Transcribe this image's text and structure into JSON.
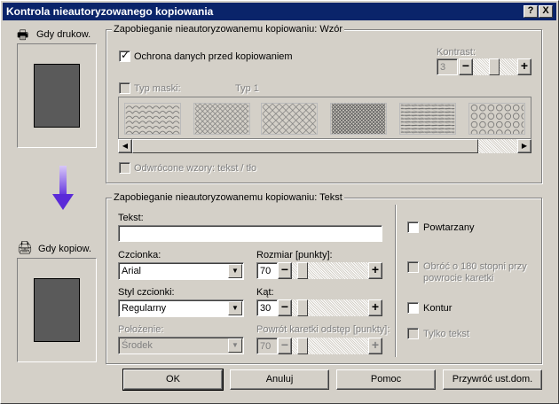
{
  "window": {
    "title": "Kontrola nieautoryzowanego kopiowania",
    "help_label": "?",
    "close_label": "X"
  },
  "left": {
    "print_label": "Gdy drukow.",
    "copy_label": "Gdy kopiow."
  },
  "pattern_group": {
    "title": "Zapobieganie nieautoryzowanemu kopiowaniu: Wzór",
    "protect_label": "Ochrona danych przed kopiowaniem",
    "protect_checked": true,
    "contrast_label": "Kontrast:",
    "contrast_value": "3",
    "mask_type_label": "Typ maski:",
    "mask_type_value": "Typ 1",
    "reverse_label": "Odwrócone wzory: tekst / tło"
  },
  "text_group": {
    "title": "Zapobieganie nieautoryzowanemu kopiowaniu: Tekst",
    "text_label": "Tekst:",
    "text_value": "",
    "font_label": "Czcionka:",
    "font_value": "Arial",
    "size_label": "Rozmiar [punkty]:",
    "size_value": "70",
    "style_label": "Styl czcionki:",
    "style_value": "Regularny",
    "angle_label": "Kąt:",
    "angle_value": "30",
    "position_label": "Położenie:",
    "position_value": "Środek",
    "return_label": "Powrót karetki odstęp [punkty]:",
    "return_value": "70",
    "repeat_label": "Powtarzany",
    "rotate_label": "Obróć o 180 stopni przy powrocie karetki",
    "outline_label": "Kontur",
    "text_only_label": "Tylko tekst"
  },
  "buttons": {
    "ok": "OK",
    "cancel": "Anuluj",
    "help": "Pomoc",
    "restore": "Przywróć ust.dom."
  },
  "glyphs": {
    "minus": "−",
    "plus": "+",
    "down": "▼",
    "left": "◀",
    "right": "▶",
    "check": "✓"
  }
}
